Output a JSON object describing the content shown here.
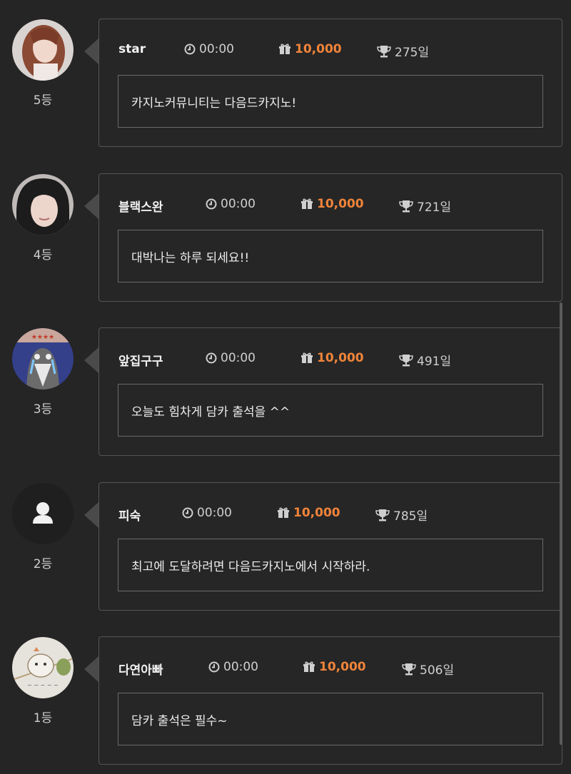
{
  "entries": [
    {
      "nickname": "star",
      "time": "00:00",
      "points": "10,000",
      "days": "275일",
      "message": "카지노커뮤니티는 다음드카지노!",
      "rank": "5등",
      "avatar": "photo-woman-long-hair"
    },
    {
      "nickname": "블랙스완",
      "time": "00:00",
      "points": "10,000",
      "days": "721일",
      "message": "대박나는 하루 되세요!!",
      "rank": "4등",
      "avatar": "photo-woman-black-hair"
    },
    {
      "nickname": "앞집구구",
      "time": "00:00",
      "points": "10,000",
      "days": "491일",
      "message": "오늘도 힘차게 담카 출석을 ^^",
      "rank": "3등",
      "avatar": "cartoon-crying-penguin"
    },
    {
      "nickname": "피숙",
      "time": "00:00",
      "points": "10,000",
      "days": "785일",
      "message": "최고에 도달하려면 다음드카지노에서 시작하라.",
      "rank": "2등",
      "avatar": "default-user-icon"
    },
    {
      "nickname": "다연아빠",
      "time": "00:00",
      "points": "10,000",
      "days": "506일",
      "message": "담카 출석은 필수~",
      "rank": "1등",
      "avatar": "photo-hamster-drawing"
    }
  ],
  "icons": {
    "time": "clock-icon",
    "points": "gift-icon",
    "days": "trophy-icon"
  },
  "colors": {
    "background": "#252525",
    "points_accent": "#f0843a",
    "border": "#555555"
  }
}
